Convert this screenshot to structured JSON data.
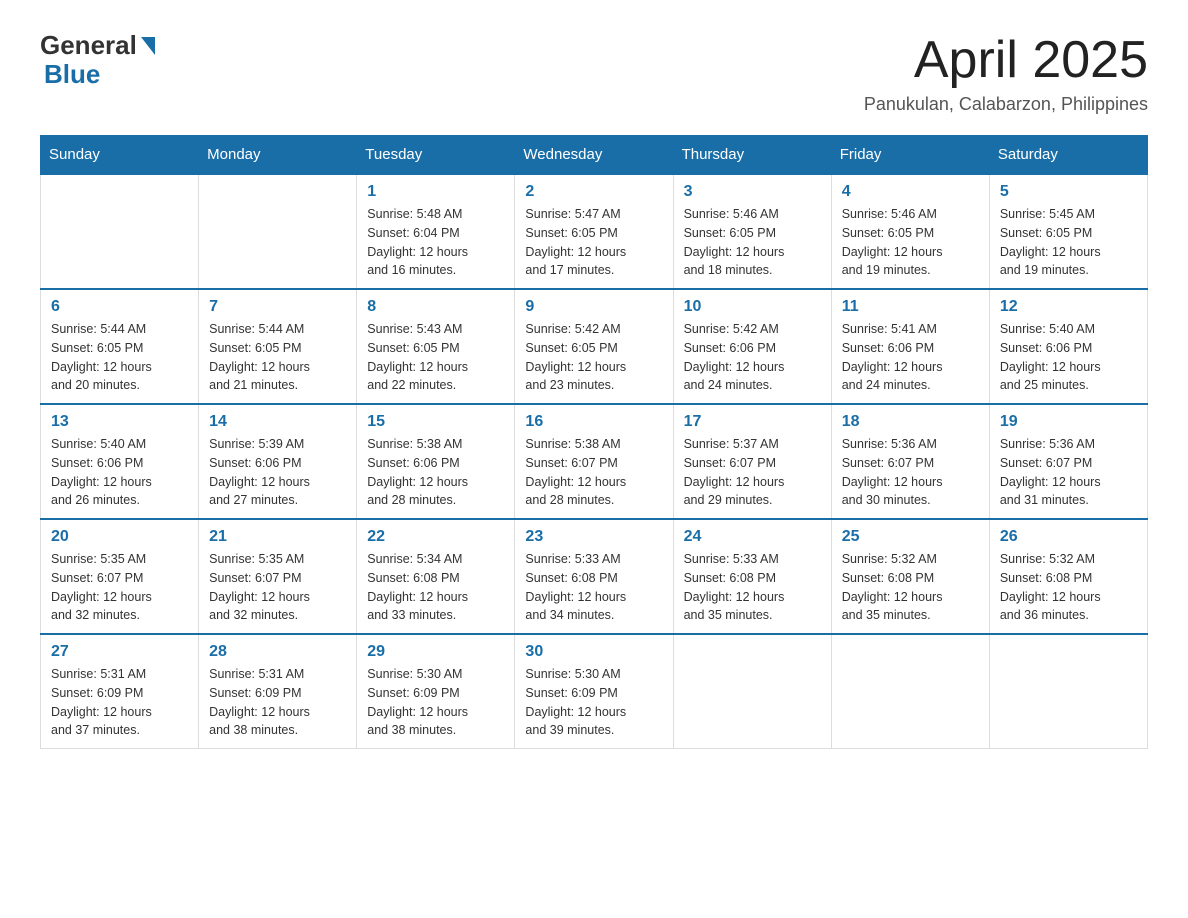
{
  "header": {
    "logo_text_general": "General",
    "logo_text_blue": "Blue",
    "month_title": "April 2025",
    "location": "Panukulan, Calabarzon, Philippines"
  },
  "days_of_week": [
    "Sunday",
    "Monday",
    "Tuesday",
    "Wednesday",
    "Thursday",
    "Friday",
    "Saturday"
  ],
  "weeks": [
    [
      {
        "day": "",
        "info": ""
      },
      {
        "day": "",
        "info": ""
      },
      {
        "day": "1",
        "info": "Sunrise: 5:48 AM\nSunset: 6:04 PM\nDaylight: 12 hours\nand 16 minutes."
      },
      {
        "day": "2",
        "info": "Sunrise: 5:47 AM\nSunset: 6:05 PM\nDaylight: 12 hours\nand 17 minutes."
      },
      {
        "day": "3",
        "info": "Sunrise: 5:46 AM\nSunset: 6:05 PM\nDaylight: 12 hours\nand 18 minutes."
      },
      {
        "day": "4",
        "info": "Sunrise: 5:46 AM\nSunset: 6:05 PM\nDaylight: 12 hours\nand 19 minutes."
      },
      {
        "day": "5",
        "info": "Sunrise: 5:45 AM\nSunset: 6:05 PM\nDaylight: 12 hours\nand 19 minutes."
      }
    ],
    [
      {
        "day": "6",
        "info": "Sunrise: 5:44 AM\nSunset: 6:05 PM\nDaylight: 12 hours\nand 20 minutes."
      },
      {
        "day": "7",
        "info": "Sunrise: 5:44 AM\nSunset: 6:05 PM\nDaylight: 12 hours\nand 21 minutes."
      },
      {
        "day": "8",
        "info": "Sunrise: 5:43 AM\nSunset: 6:05 PM\nDaylight: 12 hours\nand 22 minutes."
      },
      {
        "day": "9",
        "info": "Sunrise: 5:42 AM\nSunset: 6:05 PM\nDaylight: 12 hours\nand 23 minutes."
      },
      {
        "day": "10",
        "info": "Sunrise: 5:42 AM\nSunset: 6:06 PM\nDaylight: 12 hours\nand 24 minutes."
      },
      {
        "day": "11",
        "info": "Sunrise: 5:41 AM\nSunset: 6:06 PM\nDaylight: 12 hours\nand 24 minutes."
      },
      {
        "day": "12",
        "info": "Sunrise: 5:40 AM\nSunset: 6:06 PM\nDaylight: 12 hours\nand 25 minutes."
      }
    ],
    [
      {
        "day": "13",
        "info": "Sunrise: 5:40 AM\nSunset: 6:06 PM\nDaylight: 12 hours\nand 26 minutes."
      },
      {
        "day": "14",
        "info": "Sunrise: 5:39 AM\nSunset: 6:06 PM\nDaylight: 12 hours\nand 27 minutes."
      },
      {
        "day": "15",
        "info": "Sunrise: 5:38 AM\nSunset: 6:06 PM\nDaylight: 12 hours\nand 28 minutes."
      },
      {
        "day": "16",
        "info": "Sunrise: 5:38 AM\nSunset: 6:07 PM\nDaylight: 12 hours\nand 28 minutes."
      },
      {
        "day": "17",
        "info": "Sunrise: 5:37 AM\nSunset: 6:07 PM\nDaylight: 12 hours\nand 29 minutes."
      },
      {
        "day": "18",
        "info": "Sunrise: 5:36 AM\nSunset: 6:07 PM\nDaylight: 12 hours\nand 30 minutes."
      },
      {
        "day": "19",
        "info": "Sunrise: 5:36 AM\nSunset: 6:07 PM\nDaylight: 12 hours\nand 31 minutes."
      }
    ],
    [
      {
        "day": "20",
        "info": "Sunrise: 5:35 AM\nSunset: 6:07 PM\nDaylight: 12 hours\nand 32 minutes."
      },
      {
        "day": "21",
        "info": "Sunrise: 5:35 AM\nSunset: 6:07 PM\nDaylight: 12 hours\nand 32 minutes."
      },
      {
        "day": "22",
        "info": "Sunrise: 5:34 AM\nSunset: 6:08 PM\nDaylight: 12 hours\nand 33 minutes."
      },
      {
        "day": "23",
        "info": "Sunrise: 5:33 AM\nSunset: 6:08 PM\nDaylight: 12 hours\nand 34 minutes."
      },
      {
        "day": "24",
        "info": "Sunrise: 5:33 AM\nSunset: 6:08 PM\nDaylight: 12 hours\nand 35 minutes."
      },
      {
        "day": "25",
        "info": "Sunrise: 5:32 AM\nSunset: 6:08 PM\nDaylight: 12 hours\nand 35 minutes."
      },
      {
        "day": "26",
        "info": "Sunrise: 5:32 AM\nSunset: 6:08 PM\nDaylight: 12 hours\nand 36 minutes."
      }
    ],
    [
      {
        "day": "27",
        "info": "Sunrise: 5:31 AM\nSunset: 6:09 PM\nDaylight: 12 hours\nand 37 minutes."
      },
      {
        "day": "28",
        "info": "Sunrise: 5:31 AM\nSunset: 6:09 PM\nDaylight: 12 hours\nand 38 minutes."
      },
      {
        "day": "29",
        "info": "Sunrise: 5:30 AM\nSunset: 6:09 PM\nDaylight: 12 hours\nand 38 minutes."
      },
      {
        "day": "30",
        "info": "Sunrise: 5:30 AM\nSunset: 6:09 PM\nDaylight: 12 hours\nand 39 minutes."
      },
      {
        "day": "",
        "info": ""
      },
      {
        "day": "",
        "info": ""
      },
      {
        "day": "",
        "info": ""
      }
    ]
  ]
}
